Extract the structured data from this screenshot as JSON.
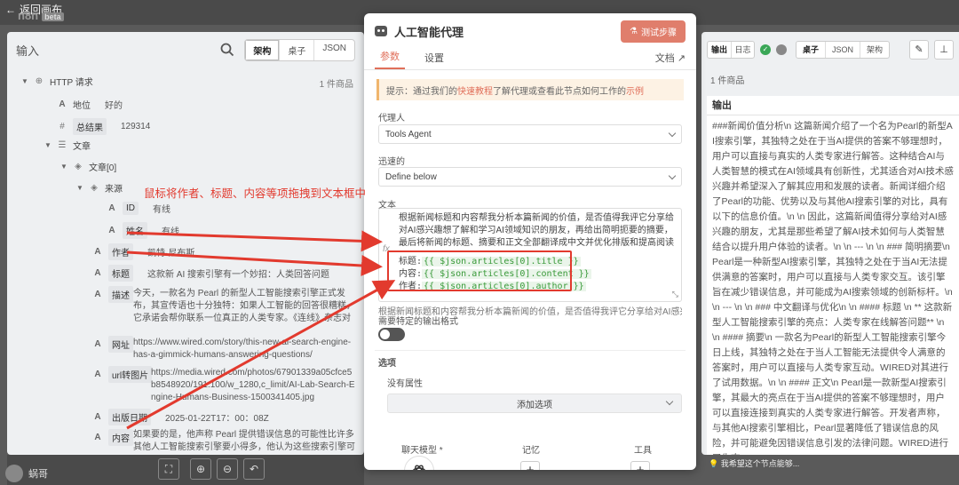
{
  "topbar": {
    "back_label": "返回画布",
    "logo": "n8n",
    "logo_badge": "beta"
  },
  "input_panel": {
    "title": "输入",
    "view_tabs": [
      "架构",
      "桌子",
      "JSON"
    ],
    "items_count": "1 件商品",
    "tree": {
      "root": "HTTP 请求",
      "address_label": "地位",
      "address_value": "好的",
      "total_label": "总结果",
      "total_value": "129314",
      "articles_label": "文章",
      "article0_label": "文章[0]",
      "source_label": "来源",
      "id_label": "ID",
      "id_value": "有线",
      "name_label": "姓名",
      "name_value": "有线",
      "author_label": "作者",
      "author_value": "凯特·尼布斯",
      "title_label": "标题",
      "title_value": "这款新 AI 搜索引擎有一个妙招：人类回答问题",
      "desc_label": "描述",
      "desc_value": "今天，一款名为 Pearl 的新型人工智能搜索引擎正式发布，其宣传语也十分独特：如果人工智能的回答很糟糕，它承诺会帮你联系一位真正的人类专家。《连线》杂志对这款搜索引擎进行了测试。",
      "url_label": "网址",
      "url_value": "https://www.wired.com/story/this-new-ai-search-engine-has-a-gimmick-humans-answering-questions/",
      "image_label": "url转图片",
      "image_value": "https://media.wired.com/photos/67901339a05cfce5b8548920/191:100/w_1280,c_limit/AI-Lab-Search-Engine-Humans-Business-1500341405.jpg",
      "date_label": "出版日期",
      "date_value": "2025-01-22T17：00：08Z",
      "content_label": "内容",
      "content_value": "如果要的是，他声称 Pearl 提供错误信息的可能性比许多其他人工智能搜索引擎要小得多，他认为这些搜索引擎可能会面临大量其不……的诉讼。 [+3887 个字符]"
    }
  },
  "annotation": "鼠标将作者、标题、内容等项拖拽到文本框中",
  "modal": {
    "title": "人工智能代理",
    "test_button": "测试步骤",
    "tabs": [
      "参数",
      "设置"
    ],
    "docs": "文档",
    "hint_prefix": "提示：通过我们的",
    "hint_link1": "快速教程",
    "hint_middle": "了解代理或查看此节点如何工作的",
    "hint_link2": "示例",
    "agent_label": "代理人",
    "agent_value": "Tools Agent",
    "prompt_label": "迅速的",
    "prompt_value": "Define below",
    "text_label": "文本",
    "text_prompt": "根据新闻标题和内容帮我分析本篇新闻的价值，是否值得我评它分享给对AI感兴趣想了解和学习AI领域知识的朋友，再给出简明扼要的摘要，最后将新闻的标题、摘要和正文全部翻译成中文并优化排版和提高阅读体验清晰。",
    "expr_title_label": "标题:",
    "expr_title": "{{ $json.articles[0].title }}",
    "expr_content_label": "内容:",
    "expr_content": "{{ $json.articles[0].content }}",
    "expr_author_label": "作者:",
    "expr_author": "{{ $json.articles[0].author }}",
    "preview": "根据新闻标题和内容帮我分析本篇新闻的价值，是否值得我评它分享给对AI感兴趣想了解和学习AI领域知识的朋友",
    "output_format_label": "需要特定的输出格式",
    "options_label": "选项",
    "no_props": "没有属性",
    "add_option": "添加选项",
    "chat_model_label": "聊天模型 *",
    "memory_label": "记忆",
    "tools_label": "工具"
  },
  "output_panel": {
    "tabs": [
      "输出",
      "日志"
    ],
    "view_tabs": [
      "桌子",
      "JSON",
      "架构"
    ],
    "items_count": "1 件商品",
    "output_title": "输出",
    "output_text": "###新闻价值分析\\n 这篇新闻介绍了一个名为Pearl的新型AI搜索引擎，其独特之处在于当AI提供的答案不够理想时，用户可以直接与真实的人类专家进行解答。这种结合AI与人类智慧的模式在AI领域具有创新性，尤其适合对AI技术感兴趣并希望深入了解其应用和发展的读者。新闻详细介绍了Pearl的功能、优势以及与其他AI搜索引擎的对比，具有以下的信息价值。\\n \\n 因此，这篇新闻值得分享给对AI感兴趣的朋友，尤其是那些希望了解AI技术如何与人类智慧结合以提升用户体验的读者。\\n \\n --- \\n \\n ### 简明摘要\\n Pearl是一种新型AI搜索引擎，其独特之处在于当AI无法提供满意的答案时，用户可以直接与人类专家交互。该引擎旨在减少错误信息，并可能成为AI搜索领域的创新标杆。\\n \\n --- \\n \\n ### 中文翻译与优化\\n \\n #### 标题 \\n ** 这款新型人工智能搜索引擎的亮点：人类专家在线解答问题** \\n \\n #### 摘要\\n 一款名为Pearl的新型人工智能搜索引擎今日上线，其独特之处在于当人工智能无法提供令人满意的答案时，用户可以直接与人类专家互动。WIRED对其进行了试用数据。\\n \\n #### 正文\\n Pearl是一款新型AI搜索引擎，其最大的亮点在于当AI提供的答案不够理想时，用户可以直接连接到真实的人类专家进行解答。开发者声称，与其他AI搜索引擎相比，Pearl显著降低了错误信息的风险，并可能避免因错误信息引发的法律问题。WIRED进行了生态",
    "feedback": "我希望这个节点能够..."
  },
  "bottom": {
    "user": "蜗哥"
  },
  "colors": {
    "accent": "#e06f5a",
    "annotation": "#e23a2e",
    "code_green": "#3a9a3a"
  }
}
